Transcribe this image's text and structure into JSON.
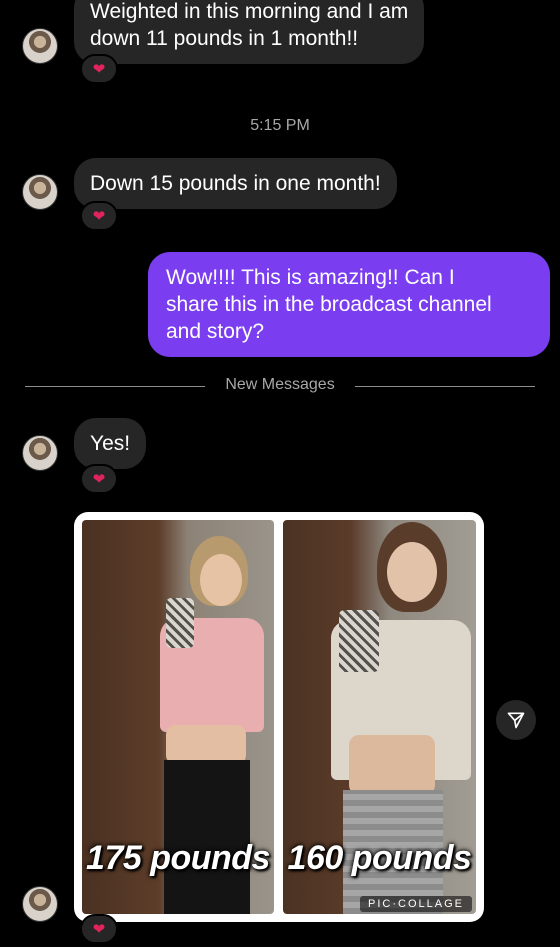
{
  "messages": [
    {
      "id": "m1",
      "text_line1": "Weighted in this morning and I am",
      "text_line2": "down 11 pounds in 1 month!!",
      "reaction": "❤"
    },
    {
      "id": "m2",
      "text": "Down 15 pounds in one month!",
      "reaction": "❤"
    },
    {
      "id": "m3",
      "text_line1": "Wow!!!! This is amazing!! Can I",
      "text_line2": "share this in the broadcast channel",
      "text_line3": "and story?"
    },
    {
      "id": "m4",
      "text": "Yes!",
      "reaction": "❤"
    },
    {
      "id": "m5",
      "reaction": "❤"
    }
  ],
  "timestamp": "5:15 PM",
  "divider_label": "New Messages",
  "photo": {
    "left_label": "175 pounds",
    "right_label": "160 pounds",
    "watermark": "PIC·COLLAGE"
  },
  "icons": {
    "avatar": "avatar-icon",
    "heart": "heart-icon",
    "share": "send-icon"
  },
  "colors": {
    "background": "#000000",
    "incoming_bubble": "#262626",
    "outgoing_bubble": "#7a3ef0",
    "heart": "#e0245e"
  }
}
